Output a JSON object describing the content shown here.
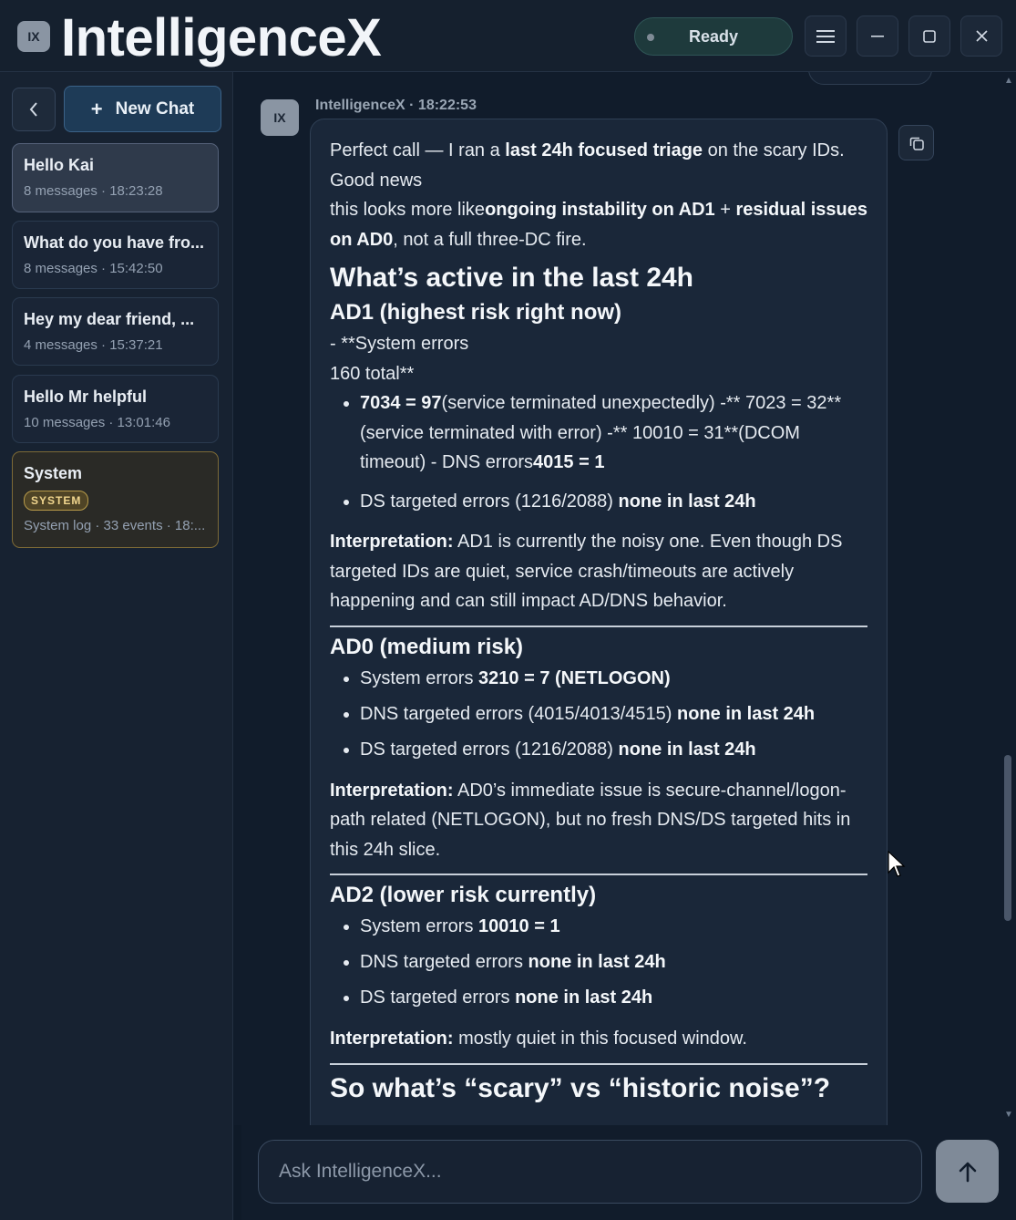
{
  "app": {
    "logo_text": "IX",
    "title": "IntelligenceX",
    "status": "Ready"
  },
  "window": {
    "menu_icon": "hamburger-menu-icon",
    "minimize_icon": "minimize-icon",
    "maximize_icon": "maximize-icon",
    "close_icon": "close-icon"
  },
  "sidebar": {
    "back_icon": "chevron-left-icon",
    "new_chat_plus": "+",
    "new_chat_label": "New Chat",
    "chats": [
      {
        "title": "Hello Kai",
        "meta": "8 messages · 18:23:28"
      },
      {
        "title": "What do you have fro...",
        "meta": "8 messages · 15:42:50"
      },
      {
        "title": "Hey my dear friend, ...",
        "meta": "4 messages · 15:37:21"
      },
      {
        "title": "Hello Mr helpful",
        "meta": "10 messages · 13:01:46"
      },
      {
        "title": "System",
        "badge": "SYSTEM",
        "meta": "System log · 33 events · 18:..."
      }
    ]
  },
  "message": {
    "avatar": "IX",
    "meta": "IntelligenceX · 18:22:53",
    "copy_icon": "copy-icon",
    "intro_1a": "Perfect call — I ran a ",
    "intro_1b": "last 24h focused triage",
    "intro_1c": " on the scary IDs.",
    "intro_2": "Good news",
    "intro_3a": "this looks more like",
    "intro_3b": "ongoing instability on AD1",
    "intro_3c": " + ",
    "intro_3d": "residual issues on AD0",
    "intro_3e": ", not a full three-DC fire.",
    "h_active": "What’s active in the last 24h",
    "ad1": {
      "heading": "AD1 (highest risk right now)",
      "line1": "- **System errors",
      "line2": "160 total**",
      "b1a": "7034 = 97",
      "b1b": "(service terminated unexpectedly) -** 7023 = 32**(service terminated with error) -** 10010 = 31**(DCOM timeout) - DNS errors",
      "b1c": "4015 = 1",
      "b2a": "DS targeted errors (1216/2088) ",
      "b2b": "none in last 24h",
      "interp_label": "Interpretation:",
      "interp_text": " AD1 is currently the noisy one. Even though DS targeted IDs are quiet, service crash/timeouts are actively happening and can still impact AD/DNS behavior."
    },
    "ad0": {
      "heading": "AD0 (medium risk)",
      "b1a": "System errors ",
      "b1b": "3210 = 7 (NETLOGON)",
      "b2a": "DNS targeted errors (4015/4013/4515) ",
      "b2b": "none in last 24h",
      "b3a": "DS targeted errors (1216/2088) ",
      "b3b": "none in last 24h",
      "interp_label": "Interpretation:",
      "interp_text": " AD0’s immediate issue is secure-channel/logon-path related (NETLOGON), but no fresh DNS/DS targeted hits in this 24h slice."
    },
    "ad2": {
      "heading": "AD2 (lower risk currently)",
      "b1a": "System errors ",
      "b1b": "10010 = 1",
      "b2a": "DNS targeted errors ",
      "b2b": "none in last 24h",
      "b3a": "DS targeted errors ",
      "b3b": "none in last 24h",
      "interp_label": "Interpretation:",
      "interp_text": " mostly quiet in this focused window."
    },
    "h_scary": "So what’s “scary” vs “historic noise”?"
  },
  "composer": {
    "placeholder": "Ask IntelligenceX...",
    "send_icon": "arrow-up-icon"
  }
}
